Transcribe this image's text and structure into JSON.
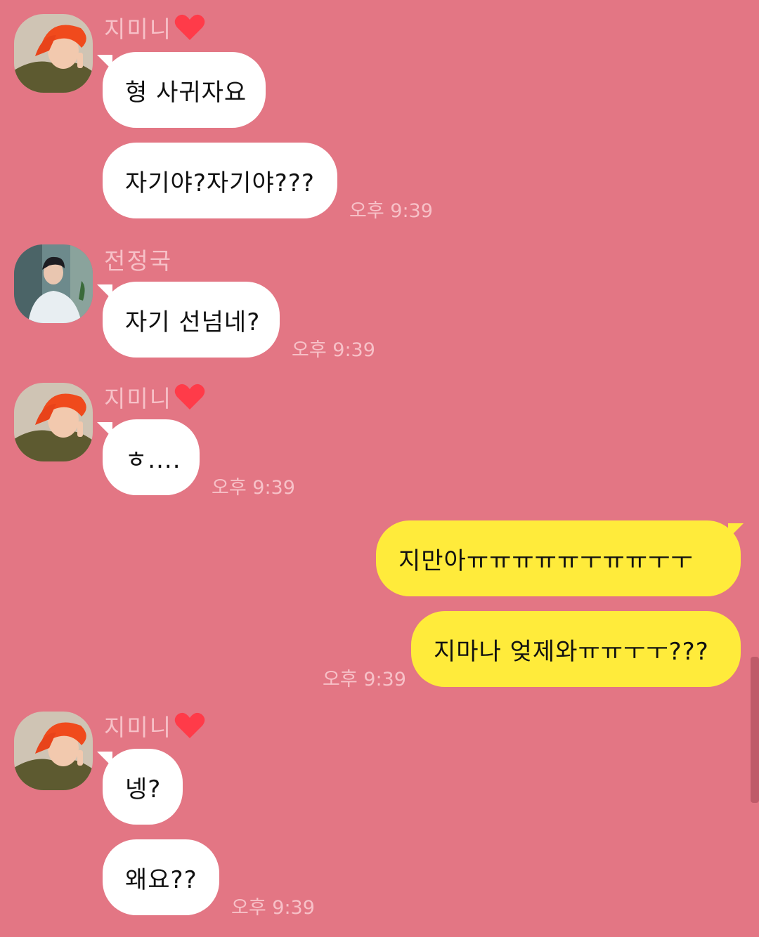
{
  "contacts": {
    "jimin": {
      "name": "지미니"
    },
    "jungkook": {
      "name": "전정국"
    }
  },
  "messages": [
    {
      "text": "형 사귀자요"
    },
    {
      "text": "자기야?자기야???"
    },
    {
      "text": "자기 선넘네?"
    },
    {
      "text": "ㅎ...."
    },
    {
      "text": "지만아ㅠㅠㅠㅠㅠㅜㅠㅠㅜㅜ"
    },
    {
      "text": "지마나 엊제와ㅠㅠㅜㅜ???"
    },
    {
      "text": "넹?"
    },
    {
      "text": "왜요??"
    }
  ],
  "timestamps": {
    "t1": "오후 9:39",
    "t2": "오후 9:39",
    "t3": "오후 9:39",
    "t4": "오후 9:39",
    "t5": "오후 9:39"
  },
  "colors": {
    "background": "#e37684",
    "own_bubble": "#ffeb3b",
    "other_bubble": "#ffffff",
    "meta_text": "#f7c1c8"
  }
}
